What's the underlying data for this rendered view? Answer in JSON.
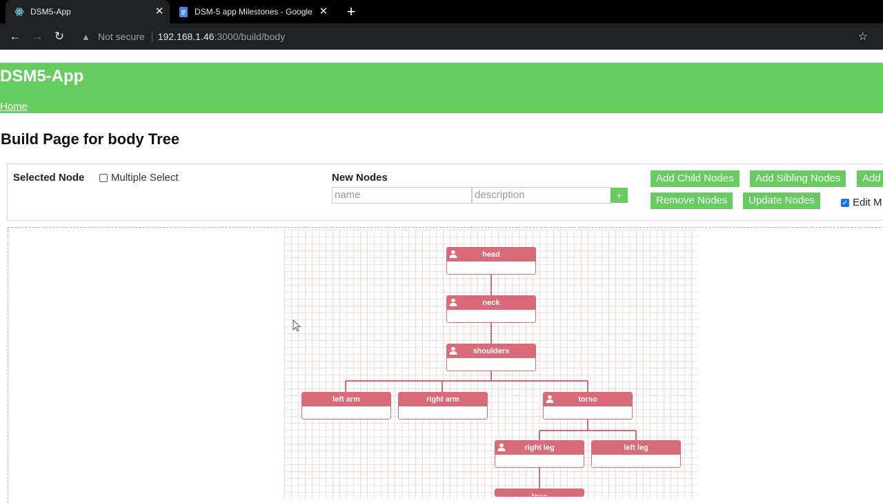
{
  "browser": {
    "tabs": [
      {
        "title": "DSM5-App",
        "active": true,
        "icon": "react-icon"
      },
      {
        "title": "DSM-5 app Milestones - Google",
        "active": false,
        "icon": "docs-icon"
      }
    ],
    "address": {
      "security": "Not secure",
      "host": "192.168.1.46",
      "path": ":3000/build/body"
    }
  },
  "app": {
    "title": "DSM5-App",
    "home_link": "Home"
  },
  "page": {
    "title": "Build Page for body Tree"
  },
  "controls": {
    "selected_node_label": "Selected Node",
    "multiple_select_label": "Multiple Select",
    "multiple_select_checked": false,
    "new_nodes_label": "New Nodes",
    "name_placeholder": "name",
    "description_placeholder": "description",
    "plus_label": "+",
    "add_child_label": "Add Child Nodes",
    "add_sibling_label": "Add Sibling Nodes",
    "add_more_label": "Add",
    "remove_label": "Remove Nodes",
    "update_label": "Update Nodes",
    "edit_mode_label": "Edit M",
    "edit_mode_checked": true
  },
  "tree": {
    "nodes": [
      "head",
      "neck",
      "shoulders",
      "left arm",
      "right arm",
      "torso",
      "right leg",
      "left leg",
      "toes"
    ],
    "colors": {
      "node": "#d96a78",
      "link": "#c0414f",
      "grid": "#f6dede"
    }
  }
}
